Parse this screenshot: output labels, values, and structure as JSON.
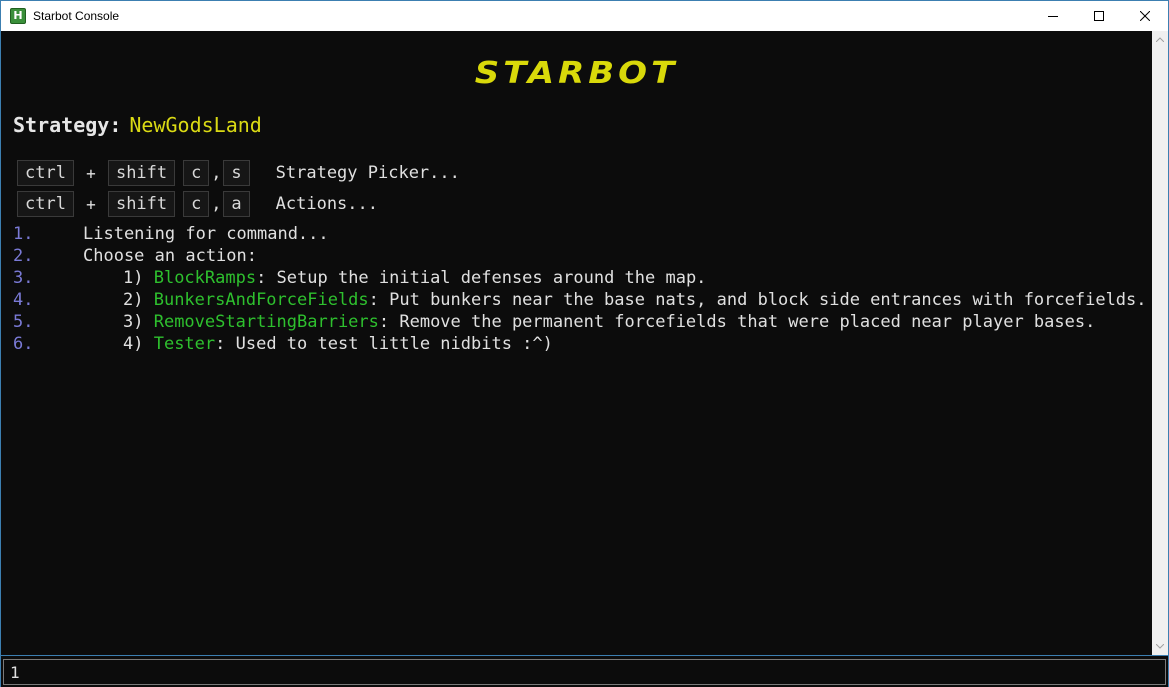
{
  "window": {
    "title": "Starbot Console",
    "icon_letter": "H"
  },
  "banner": {
    "text": "STARBOT"
  },
  "strategy": {
    "label": "Strategy:",
    "value": "NewGodsLand"
  },
  "hotkeys": [
    {
      "keys": [
        "ctrl",
        "shift",
        "c",
        "s"
      ],
      "plus": "+",
      "comma": ",",
      "description": "Strategy Picker..."
    },
    {
      "keys": [
        "ctrl",
        "shift",
        "c",
        "a"
      ],
      "plus": "+",
      "comma": ",",
      "description": "Actions..."
    }
  ],
  "output": {
    "lines": [
      {
        "num": "1.",
        "text": "Listening for command..."
      },
      {
        "num": "2.",
        "text": "Choose an action:"
      },
      {
        "num": "3.",
        "prefix": "1) ",
        "command": "BlockRamps",
        "text": ": Setup the initial defenses around the map."
      },
      {
        "num": "4.",
        "prefix": "2) ",
        "command": "BunkersAndForceFields",
        "text": ": Put bunkers near the base nats, and block side entrances with forcefields."
      },
      {
        "num": "5.",
        "prefix": "3) ",
        "command": "RemoveStartingBarriers",
        "text": ": Remove the permanent forcefields that were placed near player bases."
      },
      {
        "num": "6.",
        "prefix": "4) ",
        "command": "Tester",
        "text": ": Used to test little nidbits :^)"
      }
    ]
  },
  "input": {
    "value": "1"
  },
  "colors": {
    "background": "#0c0c0c",
    "banner": "#d9d90a",
    "strategy_value": "#dada14",
    "command": "#2ec02e",
    "line_number": "#7a7ad6",
    "window_border": "#3c7fb1"
  },
  "icons": {
    "minimize": "minimize-icon",
    "maximize": "maximize-icon",
    "close": "close-icon",
    "scroll_up": "scroll-up-arrow-icon",
    "scroll_down": "scroll-down-arrow-icon"
  }
}
